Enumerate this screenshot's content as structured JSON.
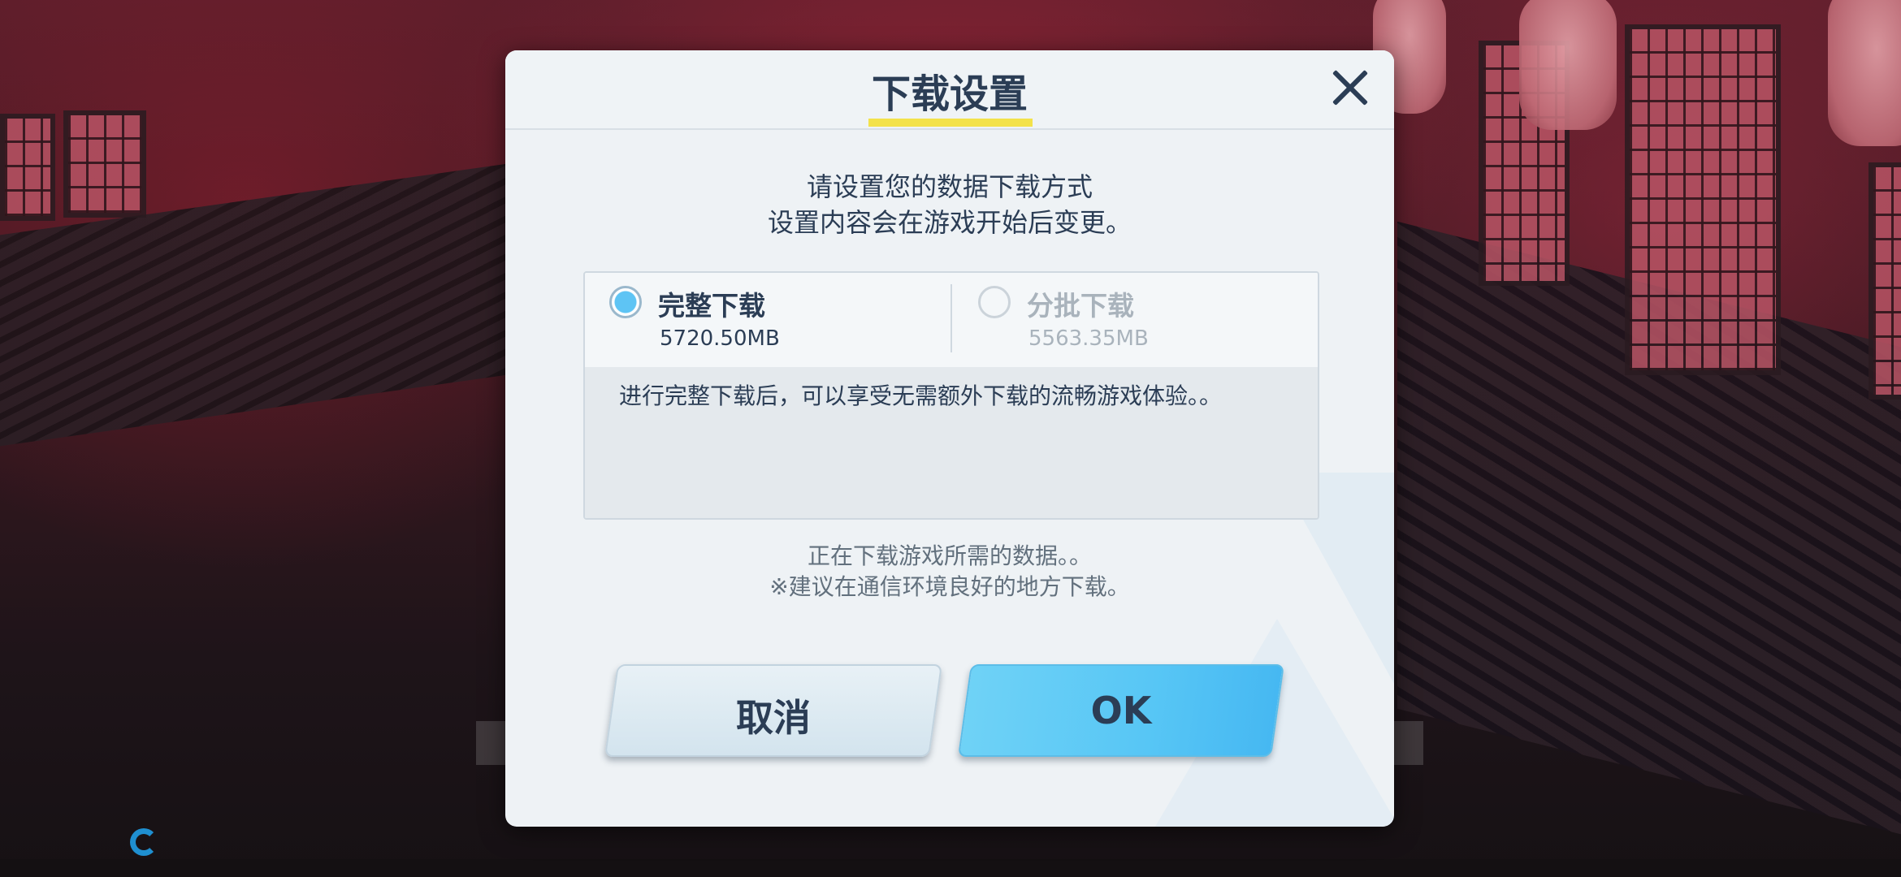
{
  "dialog": {
    "title": "下载设置",
    "instruction_line1": "请设置您的数据下载方式",
    "instruction_line2": "设置内容会在游戏开始后变更。",
    "options": [
      {
        "label": "完整下载",
        "size": "5720.50MB",
        "selected": true,
        "enabled": true
      },
      {
        "label": "分批下载",
        "size": "5563.35MB",
        "selected": false,
        "enabled": false
      }
    ],
    "description": "进行完整下载后，可以享受无需额外下载的流畅游戏体验。。",
    "notice_line1": "正在下载游戏所需的数据。。",
    "notice_line2": "※建议在通信环境良好的地方下载。",
    "cancel_label": "取消",
    "ok_label": "OK"
  },
  "colors": {
    "title_text": "#2b3d55",
    "title_underline": "#f3e24a",
    "ok_button": "#57c6f5",
    "cancel_button": "#d9e8f0",
    "radio_selected": "#5ec4f4"
  },
  "icons": {
    "close": "close-icon",
    "loading": "loading-icon"
  }
}
